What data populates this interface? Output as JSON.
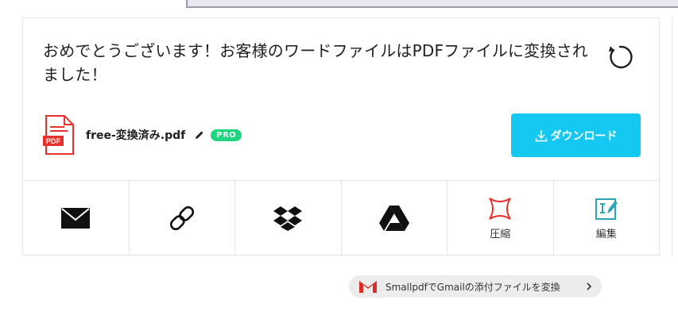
{
  "result": {
    "headline": "おめでとうございます！お客様のワードファイルはPDFファイルに変換されました！",
    "file_name": "free-変換済み.pdf",
    "pro_badge": "PRO",
    "download_label": "ダウンロード",
    "pdf_icon_text": "PDF"
  },
  "actions": [
    {
      "icon": "mail-icon",
      "label": ""
    },
    {
      "icon": "link-icon",
      "label": ""
    },
    {
      "icon": "dropbox-icon",
      "label": ""
    },
    {
      "icon": "google-drive-icon",
      "label": ""
    },
    {
      "icon": "compress-icon",
      "label": "圧縮"
    },
    {
      "icon": "edit-pdf-icon",
      "label": "編集"
    }
  ],
  "gmail": {
    "text": "SmallpdfでGmailの添付ファイルを変換"
  },
  "colors": {
    "accent": "#14c8f1",
    "pro": "#1fd680",
    "pdf_red": "#e5322d",
    "edit_teal": "#2ba5b4"
  }
}
